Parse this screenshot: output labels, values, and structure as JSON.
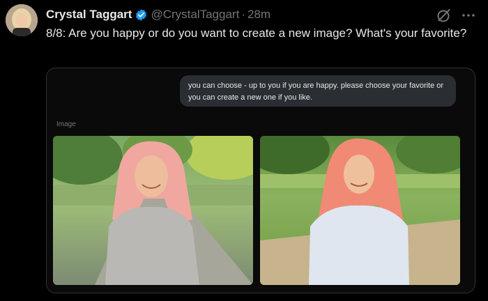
{
  "tweet": {
    "author_name": "Crystal Taggart",
    "handle": "@CrystalTaggart",
    "separator": "·",
    "time": "28m",
    "text": "8/8: Are you happy or do you want to create a new image? What's your favorite?",
    "verified": true
  },
  "card": {
    "prompt_bubble": "you can choose - up to you if you are happy. please choose your favorite or you can create a new one if you like.",
    "image_section_label": "Image",
    "images": [
      {
        "alt": "woman with pink hair in gray sweater on park path"
      },
      {
        "alt": "woman with pink hair in light blue dress in park"
      }
    ]
  },
  "colors": {
    "background": "#000000",
    "text": "#e7e9ea",
    "muted": "#71767b",
    "verified": "#1d9bf0",
    "bubble": "#2a2d31",
    "border": "#2f3336"
  },
  "icons": [
    "verified-badge-icon",
    "grok-icon",
    "more-icon"
  ]
}
